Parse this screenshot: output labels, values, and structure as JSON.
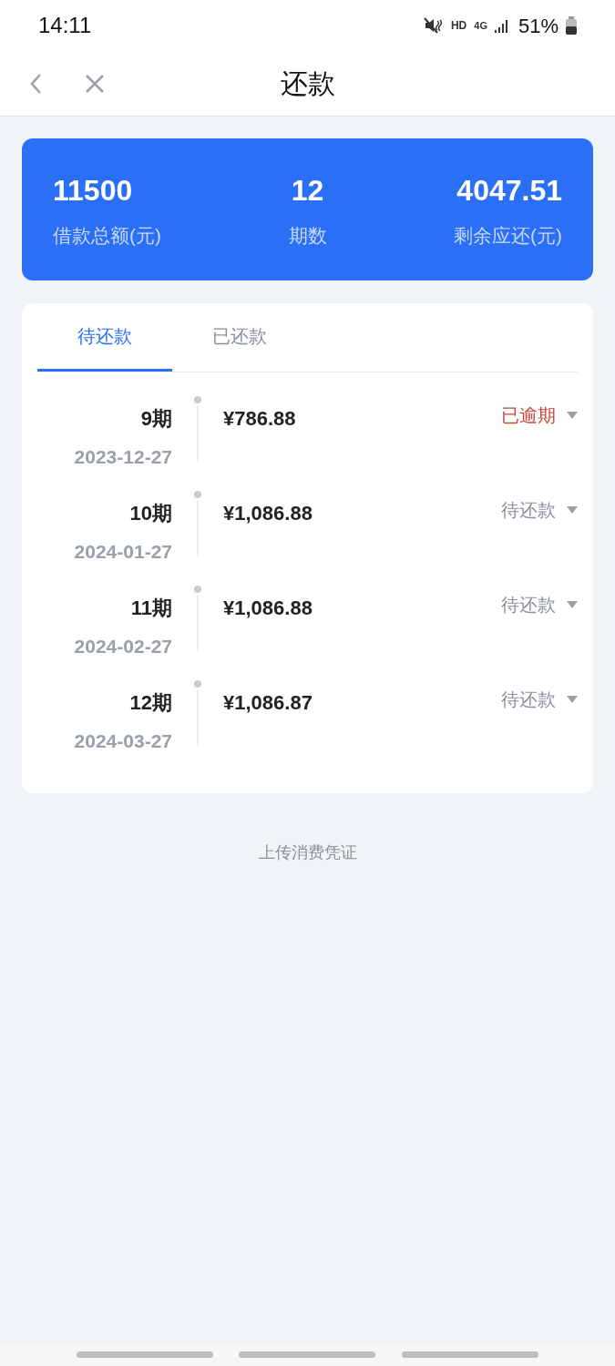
{
  "status_bar": {
    "time": "14:11",
    "hd": "HD",
    "network": "4G",
    "battery": "51%"
  },
  "nav": {
    "title": "还款"
  },
  "summary": [
    {
      "value": "11500",
      "label": "借款总额(元)"
    },
    {
      "value": "12",
      "label": "期数"
    },
    {
      "value": "4047.51",
      "label": "剩余应还(元)"
    }
  ],
  "tabs": [
    {
      "label": "待还款",
      "selected": true
    },
    {
      "label": "已还款",
      "selected": false
    }
  ],
  "installments": [
    {
      "period": "9期",
      "date": "2023-12-27",
      "amount": "¥786.88",
      "status": "已逾期",
      "kind": "overdue"
    },
    {
      "period": "10期",
      "date": "2024-01-27",
      "amount": "¥1,086.88",
      "status": "待还款",
      "kind": "pending"
    },
    {
      "period": "11期",
      "date": "2024-02-27",
      "amount": "¥1,086.88",
      "status": "待还款",
      "kind": "pending"
    },
    {
      "period": "12期",
      "date": "2024-03-27",
      "amount": "¥1,086.87",
      "status": "待还款",
      "kind": "pending"
    }
  ],
  "footer_link": "上传消费凭证"
}
